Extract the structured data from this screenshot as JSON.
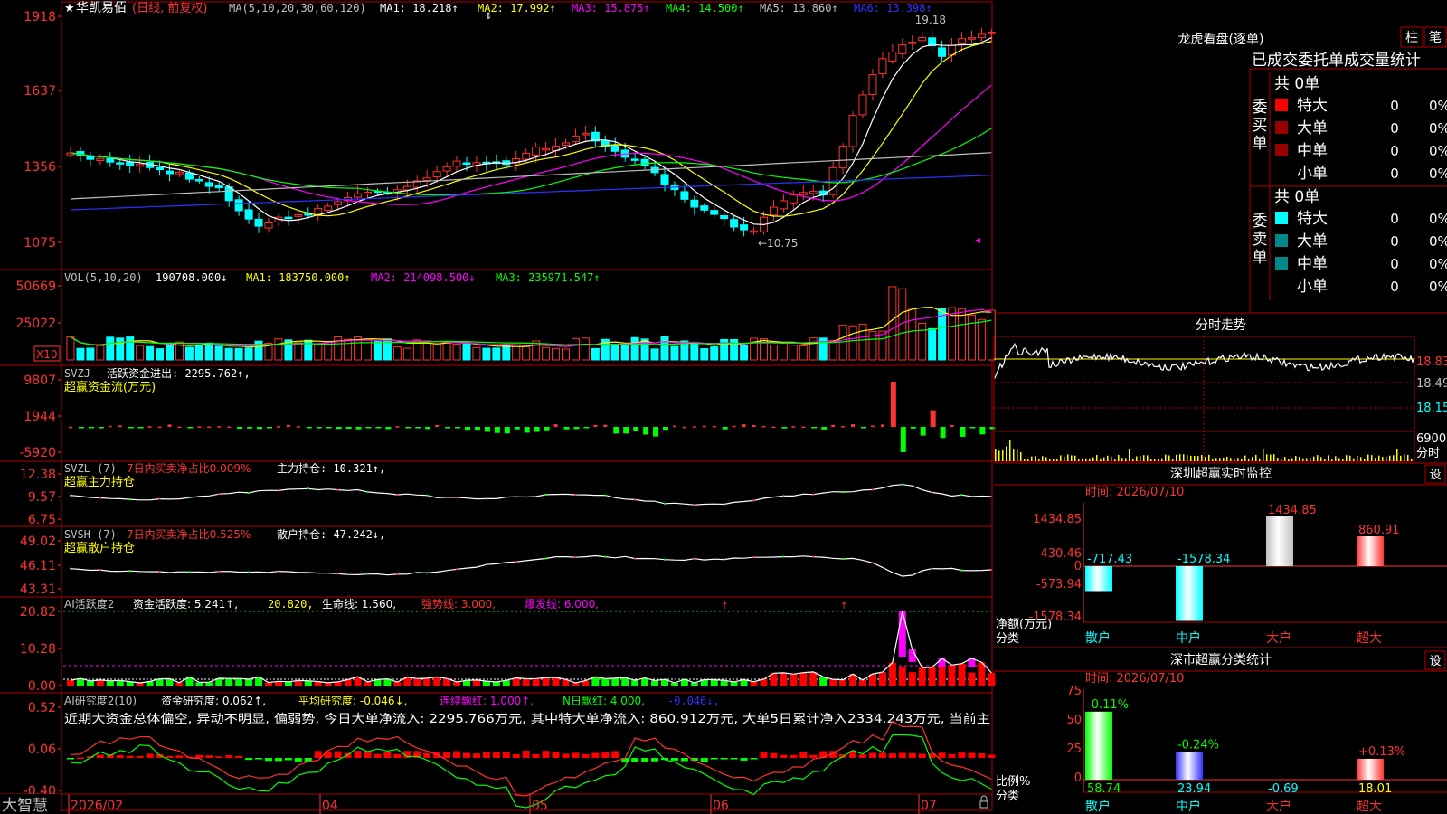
{
  "stock": {
    "name": "华凯易佰",
    "mode": "(日线, 前复权)",
    "star": "★"
  },
  "colors": {
    "up": "#ff3232",
    "down": "#00ffff",
    "grid": "#b00000",
    "axis": "#ff3232",
    "ma1": "#ffffff",
    "ma2": "#ffff00",
    "ma3": "#ff00ff",
    "ma4": "#00ff00",
    "ma5": "#c0c0c0",
    "ma6": "#3030ff"
  },
  "price_panel": {
    "y_ticks": [
      "1918",
      "1637",
      "1356",
      "1075"
    ],
    "legend": {
      "label": "MA(5,10,20,30,60,120)",
      "ma1": "MA1: 18.218↑",
      "ma2": "MA2: 17.992↑",
      "ma3": "MA3: 15.875↑",
      "ma4": "MA4: 14.500↑",
      "ma5": "MA5: 13.860↑",
      "ma6": "MA6: 13.398↑"
    },
    "high_mark": "19.18",
    "low_mark": "←10.75"
  },
  "vol_panel": {
    "y_ticks": [
      "50669",
      "25022"
    ],
    "unit": "X10",
    "legend": {
      "label": "VOL(5,10,20)",
      "vol": "190708.000↓",
      "ma1": "MA1: 183750.000↑",
      "ma2": "MA2: 214098.500↓",
      "ma3": "MA3: 235971.547↑"
    }
  },
  "svzj_panel": {
    "y_ticks": [
      "9807",
      "1944",
      "-5920"
    ],
    "legend": {
      "label": "SVZJ",
      "active": "活跃资金进出: 2295.762↑,",
      "name": "超赢资金流(万元)"
    }
  },
  "svzl_panel": {
    "y_ticks": [
      "12.38",
      "9.57",
      "6.75"
    ],
    "legend": {
      "label": "SVZL (7)",
      "ratio": "7日内买卖净占比0.009%",
      "hold": "主力持仓: 10.321↑,",
      "name": "超赢主力持仓"
    }
  },
  "svsh_panel": {
    "y_ticks": [
      "49.02",
      "46.11",
      "43.31"
    ],
    "legend": {
      "label": "SVSH (7)",
      "ratio": "7日内买卖净占比0.525%",
      "hold": "散户持仓: 47.242↓,",
      "name": "超赢散户持仓"
    }
  },
  "ai1_panel": {
    "y_ticks": [
      "20.82",
      "10.28",
      "0.00"
    ],
    "legend": {
      "label": "AI活跃度2",
      "active": "资金活跃度: 5.241↑,",
      "v2": "20.820,",
      "life": "生命线: 1.560,",
      "strong": "强势线: 3.000,",
      "burst": "爆发线: 6.000,"
    }
  },
  "ai2_panel": {
    "y_ticks": [
      "0.52",
      "0.06",
      "-0.40"
    ],
    "legend": {
      "label": "AI研究度2(10)",
      "research": "资金研究度: 0.062↑,",
      "avg": "平均研究度: -0.046↓,",
      "red": "连续飘红: 1.000↑,",
      "nred": "N日飘红: 4.000,",
      "neg": "-0.046↓,"
    },
    "comment": "近期大资金总体偏空, 异动不明显, 偏弱势, 今日大单净流入: 2295.766万元, 其中特大单净流入: 860.912万元, 大单5日累计净入2334.243万元, 当前主"
  },
  "x_axis": {
    "labels": [
      "2026/02",
      "04",
      "05",
      "06",
      "07"
    ]
  },
  "brand": "大智慧",
  "lhkp": {
    "title": "龙虎看盘(逐单)",
    "tab1": "柱",
    "tab2": "笔",
    "subtitle": "已成交委托单成交量统计",
    "buy": {
      "label": "委买单",
      "total": "共 0单",
      "rows": [
        {
          "name": "特大",
          "count": "0",
          "pct": "0%"
        },
        {
          "name": "大单",
          "count": "0",
          "pct": "0%"
        },
        {
          "name": "中单",
          "count": "0",
          "pct": "0%"
        },
        {
          "name": "小单",
          "count": "0",
          "pct": "0%"
        }
      ]
    },
    "sell": {
      "label": "委卖单",
      "total": "共 0单",
      "rows": [
        {
          "name": "特大",
          "count": "0",
          "pct": "0%"
        },
        {
          "name": "大单",
          "count": "0",
          "pct": "0%"
        },
        {
          "name": "中单",
          "count": "0",
          "pct": "0%"
        },
        {
          "name": "小单",
          "count": "0",
          "pct": "0%"
        }
      ]
    }
  },
  "intraday": {
    "title": "分时走势",
    "y_ticks": [
      "18.83",
      "18.49",
      "18.15"
    ],
    "vol_tick": "6900",
    "vol_label": "分时"
  },
  "sz_monitor": {
    "title": "深圳超赢实时监控",
    "setting": "设",
    "time": "时间: 2026/07/10",
    "y_ticks": [
      "1434.85",
      "430.46",
      "0",
      "-573.94",
      "-1578.34"
    ],
    "ylabel1": "净额(万元)",
    "ylabel2": "分类",
    "bars": [
      {
        "cat": "散户",
        "value": -717.43,
        "label": "-717.43"
      },
      {
        "cat": "中户",
        "value": -1578.34,
        "label": "-1578.34"
      },
      {
        "cat": "大户",
        "value": 1434.85,
        "label": "1434.85"
      },
      {
        "cat": "超大",
        "value": 860.91,
        "label": "860.91"
      }
    ]
  },
  "sz_classify": {
    "title": "深市超赢分类统计",
    "setting": "设",
    "time": "时间: 2026/07/10",
    "y_ticks": [
      "75",
      "50",
      "25",
      "0"
    ],
    "ylabel1": "比例%",
    "ylabel2": "分类",
    "bars": [
      {
        "cat": "散户",
        "value": 58.74,
        "top": "-0.11%",
        "bottom": "58.74"
      },
      {
        "cat": "中户",
        "value": 23.94,
        "top": "-0.24%",
        "bottom": "23.94"
      },
      {
        "cat": "大户",
        "value": -0.69,
        "top": "",
        "bottom": "-0.69"
      },
      {
        "cat": "超大",
        "value": 18.01,
        "top": "+0.13%",
        "bottom": "18.01"
      }
    ]
  }
}
